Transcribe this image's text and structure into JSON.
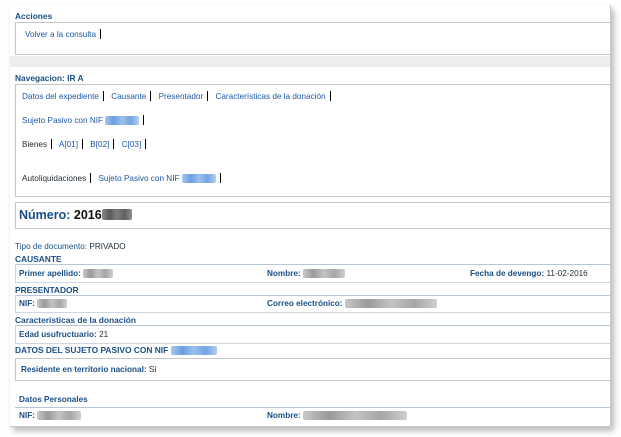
{
  "acciones": {
    "title": "Acciones",
    "volver": "Volver a la consulta"
  },
  "navegacion": {
    "title": "Navegacion: IR A",
    "links": [
      "Datos del expediente",
      "Causante",
      "Presentador",
      "Características de la donación"
    ],
    "sujeto_pasivo": "Sujeto Pasivo con NIF",
    "bienes_label": "Bienes",
    "bienes_links": [
      "A[01]",
      "B[02]",
      "C[03]"
    ],
    "autoliquidaciones_label": "Autoliquidaciones",
    "autoliq_sujeto": "Sujeto Pasivo con NIF"
  },
  "numero": {
    "label": "Número:",
    "value": "2016"
  },
  "documento": {
    "label": "Tipo de documento:",
    "value": "PRIVADO"
  },
  "causante": {
    "title": "CAUSANTE",
    "primer_apellido": "Primer apellido:",
    "nombre": "Nombre:",
    "fecha_label": "Fecha de devengo:",
    "fecha_value": "11-02-2016"
  },
  "presentador": {
    "title": "PRESENTADOR",
    "nif": "NIF:",
    "correo": "Correo electrónico:"
  },
  "caracteristicas": {
    "title": "Características de la donación",
    "edad_label": "Edad usufructuario:",
    "edad_value": "21"
  },
  "sujeto": {
    "title": "DATOS DEL SUJETO PASIVO CON NIF",
    "residente_label": "Residente en territorio nacional:",
    "residente_value": "Sí",
    "datos_personales": "Datos Personales",
    "nif": "NIF:",
    "nombre": "Nombre:"
  },
  "colors": {
    "accent": "#1a4f86",
    "link": "#1f57a6",
    "redacted_link": "#6b9ee0"
  }
}
